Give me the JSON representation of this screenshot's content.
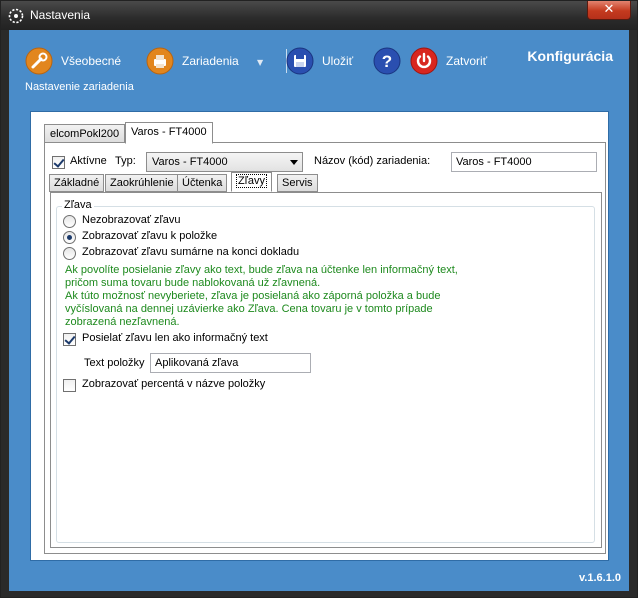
{
  "window": {
    "title": "Nastavenia",
    "close_glyph": "✕"
  },
  "toolbar": {
    "general_label": "Všeobecné",
    "devices_label": "Zariadenia",
    "save_label": "Uložiť",
    "close_label": "Zatvoriť",
    "brand": "Konfigurácia",
    "subtitle": "Nastavenie zariadenia"
  },
  "device_tabs": [
    {
      "label": "elcomPokl200",
      "active": false
    },
    {
      "label": "Varos - FT4000",
      "active": true
    }
  ],
  "device": {
    "active_label": "Aktívne",
    "active_checked": true,
    "type_label": "Typ:",
    "type_value": "Varos - FT4000",
    "name_label": "Názov (kód) zariadenia:",
    "name_value": "Varos - FT4000"
  },
  "sub_tabs": [
    {
      "label": "Základné",
      "active": false
    },
    {
      "label": "Zaokrúhlenie",
      "active": false
    },
    {
      "label": "Účtenka",
      "active": false
    },
    {
      "label": "Zľavy",
      "active": true
    },
    {
      "label": "Servis",
      "active": false
    }
  ],
  "discount": {
    "group_title": "Zľava",
    "options": [
      {
        "label": "Nezobrazovať zľavu",
        "selected": false
      },
      {
        "label": "Zobrazovať zľavu k položke",
        "selected": true
      },
      {
        "label": "Zobrazovať zľavu sumárne na konci dokladu",
        "selected": false
      }
    ],
    "info_lines": [
      "Ak povolíte posielanie zľavy ako text, bude zľava na účtenke len informačný text,",
      "pričom suma tovaru bude nablokovaná už zľavnená.",
      "Ak túto možnosť nevyberiete, zľava je posielaná ako záporná položka a bude",
      "vyčíslovaná na dennej uzávierke ako Zľava. Cena tovaru je v tomto prípade",
      "zobrazená nezľavnená."
    ],
    "send_as_text_label": "Posielať zľavu len ako informačný text",
    "send_as_text_checked": true,
    "item_text_label": "Text položky",
    "item_text_value": "Aplikovaná zľava",
    "show_percent_label": "Zobrazovať percentá v názve položky",
    "show_percent_checked": false
  },
  "version": "v.1.6.1.0",
  "colors": {
    "accent": "#4a8cc9",
    "info_text": "#1e8a1e"
  }
}
